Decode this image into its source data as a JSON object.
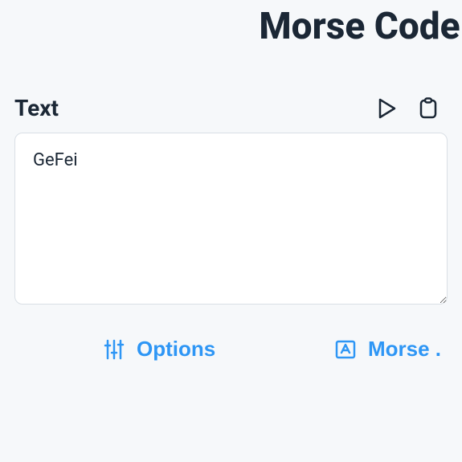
{
  "title": "Morse Code",
  "input": {
    "label": "Text",
    "value": "GeFei"
  },
  "actions": {
    "options_label": "Options",
    "morse_label": "Morse ."
  }
}
